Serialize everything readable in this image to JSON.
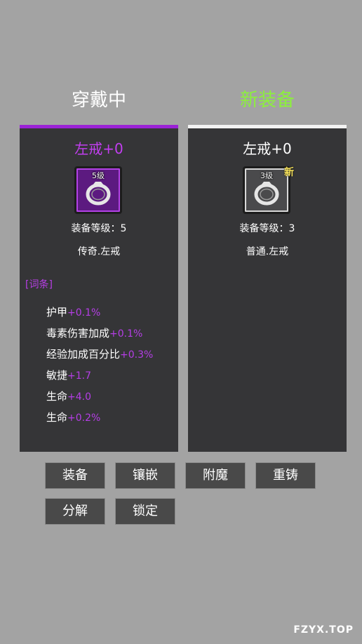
{
  "titles": {
    "current": "穿戴中",
    "new": "新装备"
  },
  "current_item": {
    "name": "左戒+0",
    "level_badge": "5级",
    "equip_level": "装备等级：5",
    "rarity_type": "传奇.左戒",
    "affix_header": "[词条]",
    "stats": [
      {
        "label": "护甲",
        "value": "+0.1%"
      },
      {
        "label": "毒素伤害加成",
        "value": "+0.1%"
      },
      {
        "label": "经验加成百分比",
        "value": "+0.3%"
      },
      {
        "label": "敏捷",
        "value": "+1.7"
      },
      {
        "label": "生命",
        "value": "+4.0"
      },
      {
        "label": "生命",
        "value": "+0.2%"
      }
    ],
    "icon": "ring-icon",
    "color": "#9b22d6"
  },
  "new_item": {
    "name": "左戒+0",
    "level_badge": "3级",
    "new_tag": "新",
    "equip_level": "装备等级：3",
    "rarity_type": "普通.左戒",
    "icon": "ring-icon",
    "color": "#f2f2f2"
  },
  "buttons": {
    "equip": "装备",
    "inlay": "镶嵌",
    "enchant": "附魔",
    "recast": "重铸",
    "dismantle": "分解",
    "lock": "锁定"
  },
  "watermark": "FZYX.TOP"
}
